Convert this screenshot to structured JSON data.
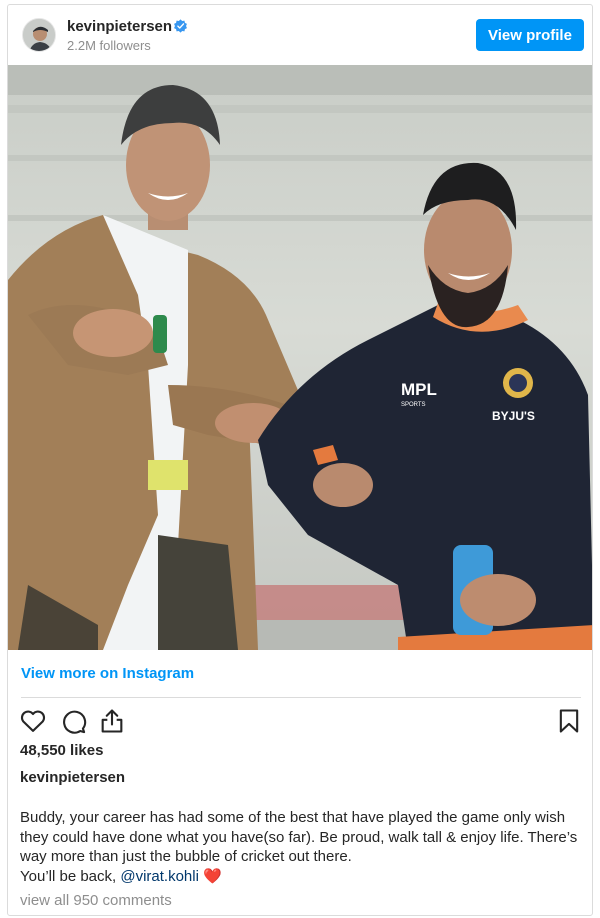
{
  "header": {
    "username": "kevinpietersen",
    "followers": "2.2M followers",
    "view_profile_label": "View profile",
    "verified_icon": "verified-badge-icon",
    "accent_color": "#0095f6"
  },
  "post": {
    "photo_description": "",
    "view_more_label": "View more on Instagram",
    "likes": "48,550 likes",
    "caption_username": "kevinpietersen",
    "caption_text": "Buddy, your career has had some of the best that have played the game only wish they could have done what you have(so far). Be proud, walk tall & enjoy life. There’s way more than just the bubble of cricket out there.",
    "caption_line2_prefix": "You’ll be back, ",
    "mention": "@virat.kohli",
    "emoji": "❤️",
    "view_comments": "view all 950 comments"
  },
  "icons": {
    "like": "heart-icon",
    "comment": "comment-icon",
    "share": "share-icon",
    "save": "bookmark-icon"
  },
  "photo_text": {
    "jersey_brand": "MPL",
    "jersey_brand_small": "SPORTS",
    "jersey_sponsor": "BYJU'S"
  }
}
